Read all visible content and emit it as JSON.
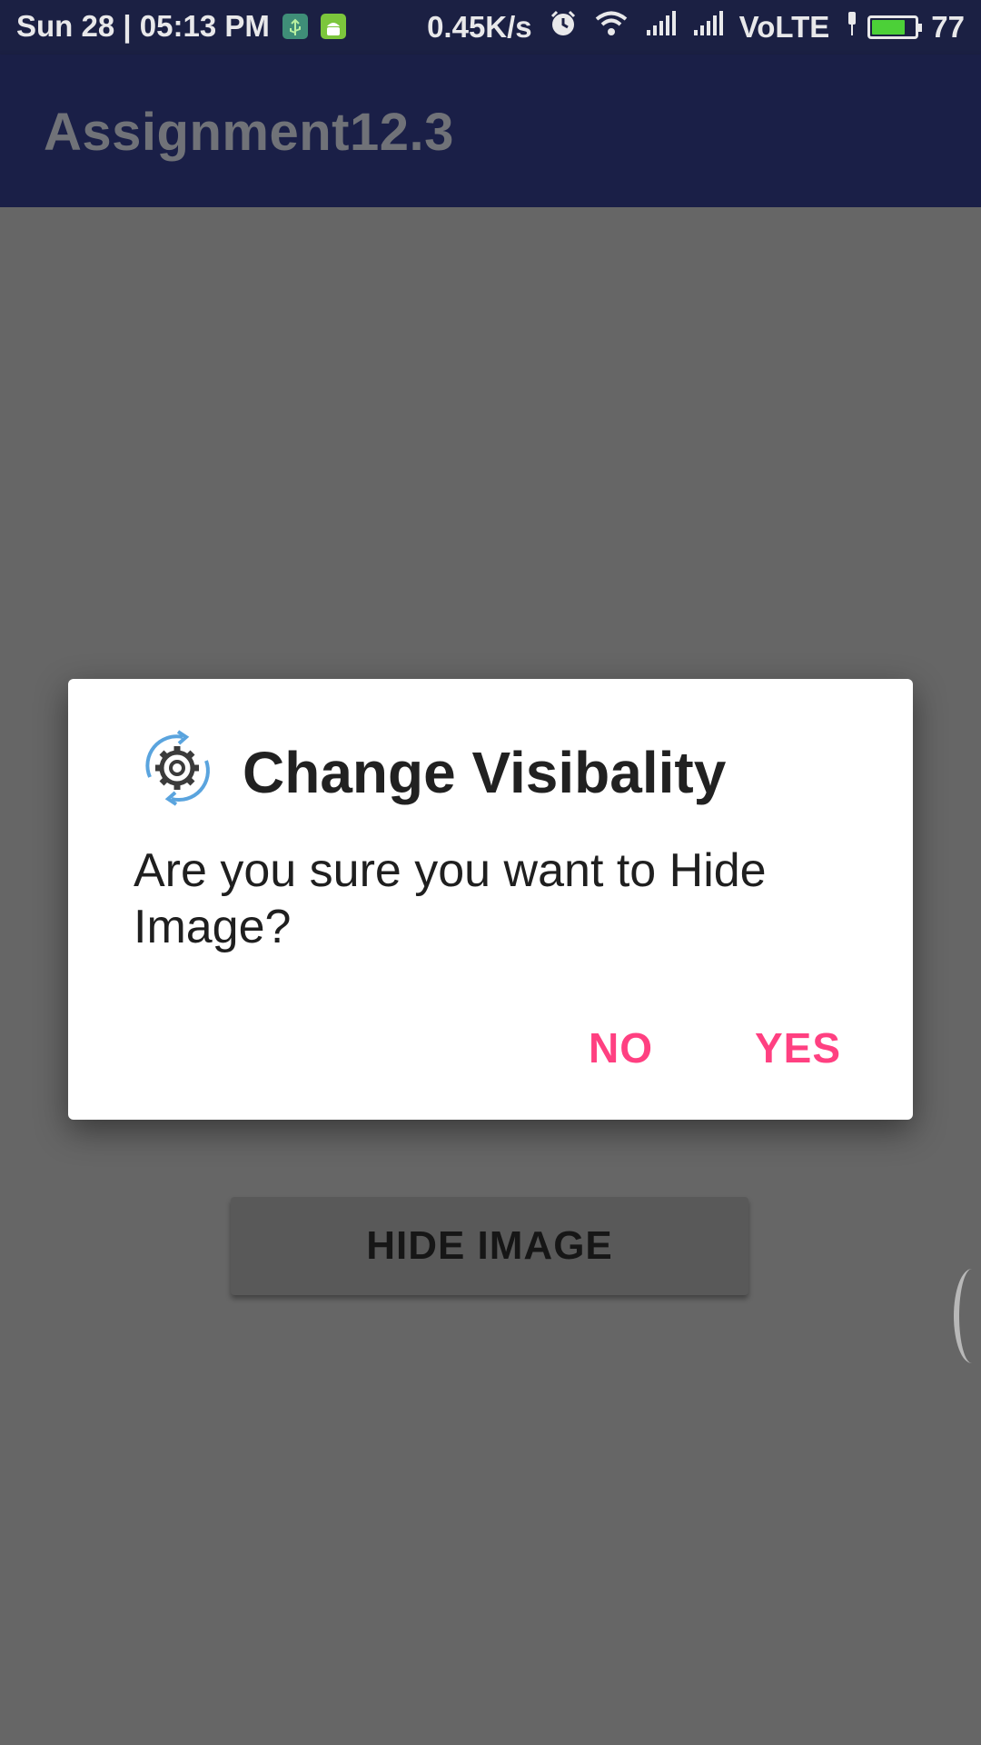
{
  "status_bar": {
    "datetime": "Sun 28 | 05:13 PM",
    "speed": "0.45K/s",
    "network": "VoLTE",
    "battery_level": "77",
    "battery_fraction": 0.77,
    "icons": [
      "usb-notification-icon",
      "android-notification-icon",
      "alarm-icon",
      "wifi-icon",
      "signal-icon",
      "signal-icon",
      "charging-icon",
      "battery-icon"
    ]
  },
  "app_bar": {
    "title": "Assignment12.3"
  },
  "main": {
    "hide_button_label": "HIDE IMAGE"
  },
  "dialog": {
    "title": "Change Visibality",
    "message": "Are you sure you want to Hide Image?",
    "icon": "settings-sync-icon",
    "negative_label": "NO",
    "positive_label": "YES",
    "accent_color": "#ff4081"
  },
  "colors": {
    "status_bar": "#1b2043",
    "app_bar": "#1a1f47",
    "scrim_background": "#666666",
    "dialog_background": "#ffffff",
    "battery_fill": "#4cd038"
  }
}
